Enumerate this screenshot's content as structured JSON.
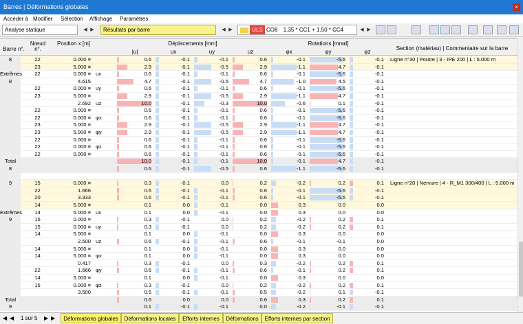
{
  "window": {
    "title": "Barres | Déformations globales",
    "close": "×"
  },
  "menu": [
    "Accéder à",
    "Modifier",
    "Sélection",
    "Affichage",
    "Paramètres"
  ],
  "toolbar": {
    "analysis": "Analyse statique",
    "results": "Résultats par barre",
    "uls": "ULS",
    "co": "CO8",
    "combo": "1.35 * CC1 + 1.50 * CC4"
  },
  "headers": {
    "bar": "Barre n°.",
    "node": "Nœud n°.",
    "pos": "Position x [m]",
    "disp_group": "Déplacements [mm]",
    "rot_group": "Rotations [mrad]",
    "u": "|u|",
    "ux": "ux",
    "uy": "uy",
    "uz": "uz",
    "px": "φx",
    "py": "φy",
    "pz": "φz",
    "section": "Section (matériau) | Commentaire sur la barre"
  },
  "rows": [
    {
      "bar": "8",
      "node": "22",
      "pos": "0.000 ≡",
      "lab": "",
      "v": [
        "0.6",
        "-0.1",
        "-0.1",
        "0.6",
        "-0.1",
        "-5.6",
        "-0.1"
      ],
      "com": "Ligne n°30 | Poutre | 3 - IPE 200 | L : 5.000 m",
      "cls": "yellowrow"
    },
    {
      "bar": "",
      "node": "23",
      "pos": "5.000 ≡",
      "lab": "",
      "v": [
        "2.9",
        "-0.1",
        "-0.5",
        "2.9",
        "-1.1",
        "4.7",
        "-0.1"
      ],
      "com": "",
      "cls": "yellowrow"
    },
    {
      "bar": "Extrêmes",
      "node": "22",
      "pos": "0.000 ≡",
      "lab": "ux",
      "v": [
        "0.6",
        "-0.1",
        "-0.1",
        "0.6",
        "-0.1",
        "-5.6",
        "-0.1"
      ],
      "com": "",
      "cls": ""
    },
    {
      "bar": "8",
      "node": "",
      "pos": "4.615",
      "lab": "",
      "v": [
        "4.7",
        "-0.1",
        "-0.5",
        "4.7",
        "-1.0",
        "4.5",
        "-0.1"
      ],
      "com": "",
      "cls": ""
    },
    {
      "bar": "",
      "node": "22",
      "pos": "0.000 ≡",
      "lab": "uy",
      "v": [
        "0.6",
        "-0.1",
        "-0.1",
        "0.6",
        "-0.1",
        "-5.6",
        "-0.1"
      ],
      "com": "",
      "cls": ""
    },
    {
      "bar": "",
      "node": "23",
      "pos": "5.000 ≡",
      "lab": "",
      "v": [
        "2.9",
        "-0.1",
        "-0.5",
        "2.9",
        "-1.1",
        "4.7",
        "-0.1"
      ],
      "com": "",
      "cls": ""
    },
    {
      "bar": "",
      "node": "",
      "pos": "2.692",
      "lab": "uz",
      "v": [
        "10.0",
        "-0.1",
        "-0.3",
        "10.0",
        "-0.6",
        "0.1",
        "-0.1"
      ],
      "com": "",
      "cls": ""
    },
    {
      "bar": "",
      "node": "22",
      "pos": "0.000 ≡",
      "lab": "",
      "v": [
        "0.6",
        "-0.1",
        "-0.1",
        "0.6",
        "-0.1",
        "-5.6",
        "-0.1"
      ],
      "com": "",
      "cls": ""
    },
    {
      "bar": "",
      "node": "22",
      "pos": "0.000 ≡",
      "lab": "φx",
      "v": [
        "0.6",
        "-0.1",
        "-0.1",
        "0.6",
        "-0.1",
        "-5.6",
        "-0.1"
      ],
      "com": "",
      "cls": ""
    },
    {
      "bar": "",
      "node": "23",
      "pos": "5.000 ≡",
      "lab": "",
      "v": [
        "2.9",
        "-0.1",
        "-0.5",
        "2.9",
        "-1.1",
        "4.7",
        "-0.1"
      ],
      "com": "",
      "cls": ""
    },
    {
      "bar": "",
      "node": "23",
      "pos": "5.000 ≡",
      "lab": "φy",
      "v": [
        "2.9",
        "-0.1",
        "-0.5",
        "2.9",
        "-1.1",
        "4.7",
        "-0.1"
      ],
      "com": "",
      "cls": ""
    },
    {
      "bar": "",
      "node": "22",
      "pos": "0.000 ≡",
      "lab": "",
      "v": [
        "0.6",
        "-0.1",
        "-0.1",
        "0.6",
        "-0.1",
        "-5.6",
        "-0.1"
      ],
      "com": "",
      "cls": ""
    },
    {
      "bar": "",
      "node": "22",
      "pos": "0.000 ≡",
      "lab": "φz",
      "v": [
        "0.6",
        "-0.1",
        "-0.1",
        "0.6",
        "-0.1",
        "-5.6",
        "-0.1"
      ],
      "com": "",
      "cls": ""
    },
    {
      "bar": "",
      "node": "22",
      "pos": "0.000 ≡",
      "lab": "",
      "v": [
        "0.6",
        "-0.1",
        "-0.1",
        "0.6",
        "-0.1",
        "-5.6",
        "-0.1"
      ],
      "com": "",
      "cls": ""
    },
    {
      "bar": "Total",
      "node": "",
      "pos": "",
      "lab": "",
      "v": [
        "10.0",
        "-0.1",
        "-0.1",
        "10.0",
        "-0.1",
        "4.7",
        "-0.1"
      ],
      "com": "",
      "cls": "grayrow"
    },
    {
      "bar": "8",
      "node": "",
      "pos": "",
      "lab": "",
      "v": [
        "0.6",
        "-0.1",
        "-0.5",
        "0.6",
        "-1.1",
        "-5.6",
        "-0.1"
      ],
      "com": "",
      "cls": "grayrow"
    },
    {
      "bar": "",
      "node": "",
      "pos": "",
      "lab": "",
      "v": [
        "",
        "",
        "",
        "",
        "",
        "",
        ""
      ],
      "com": "",
      "cls": ""
    },
    {
      "bar": "9",
      "node": "15",
      "pos": "0.000 ≡",
      "lab": "",
      "v": [
        "0.3",
        "-0.1",
        "0.0",
        "0.2",
        "-0.2",
        "0.2",
        "0.1"
      ],
      "com": "Ligne n°20 | Nervure | 4 - R_M1 300/400 | L : 5.000 m",
      "cls": "yellowrow"
    },
    {
      "bar": "",
      "node": "22",
      "pos": "1.666",
      "lab": "",
      "v": [
        "0.6",
        "-0.1",
        "-0.1",
        "0.6",
        "-0.1",
        "-5.6",
        "-0.1"
      ],
      "com": "",
      "cls": "yellowrow"
    },
    {
      "bar": "",
      "node": "20",
      "pos": "3.333",
      "lab": "",
      "v": [
        "0.6",
        "-0.1",
        "-0.1",
        "0.6",
        "-0.1",
        "-5.6",
        "-0.1"
      ],
      "com": "",
      "cls": "yellowrow"
    },
    {
      "bar": "",
      "node": "14",
      "pos": "5.000 ≡",
      "lab": "",
      "v": [
        "0.1",
        "0.0",
        "-0.1",
        "0.0",
        "0.3",
        "0.0",
        "0.0"
      ],
      "com": "",
      "cls": "yellowrow"
    },
    {
      "bar": "Extrêmes",
      "node": "14",
      "pos": "5.000 ≡",
      "lab": "ux",
      "v": [
        "0.1",
        "0.0",
        "-0.1",
        "0.0",
        "0.3",
        "0.0",
        "0.0"
      ],
      "com": "",
      "cls": ""
    },
    {
      "bar": "9",
      "node": "15",
      "pos": "0.000 ≡",
      "lab": "",
      "v": [
        "0.3",
        "-0.1",
        "0.0",
        "0.2",
        "-0.2",
        "0.2",
        "0.1"
      ],
      "com": "",
      "cls": ""
    },
    {
      "bar": "",
      "node": "15",
      "pos": "0.000 ≡",
      "lab": "uy",
      "v": [
        "0.3",
        "-0.1",
        "0.0",
        "0.2",
        "-0.2",
        "0.2",
        "0.1"
      ],
      "com": "",
      "cls": ""
    },
    {
      "bar": "",
      "node": "14",
      "pos": "5.000 ≡",
      "lab": "",
      "v": [
        "0.1",
        "0.0",
        "-0.1",
        "0.0",
        "0.3",
        "0.0",
        "0.0"
      ],
      "com": "",
      "cls": ""
    },
    {
      "bar": "",
      "node": "",
      "pos": "2.500",
      "lab": "uz",
      "v": [
        "0.6",
        "-0.1",
        "-0.1",
        "0.6",
        "-0.1",
        "-0.1",
        "0.0"
      ],
      "com": "",
      "cls": ""
    },
    {
      "bar": "",
      "node": "14",
      "pos": "5.000 ≡",
      "lab": "",
      "v": [
        "0.1",
        "0.0",
        "-0.1",
        "0.0",
        "0.3",
        "0.0",
        "0.0"
      ],
      "com": "",
      "cls": ""
    },
    {
      "bar": "",
      "node": "14",
      "pos": "5.000 ≡",
      "lab": "φx",
      "v": [
        "0.1",
        "0.0",
        "-0.1",
        "0.0",
        "0.3",
        "0.0",
        "0.0"
      ],
      "com": "",
      "cls": ""
    },
    {
      "bar": "",
      "node": "",
      "pos": "0.417",
      "lab": "",
      "v": [
        "0.3",
        "-0.1",
        "0.0",
        "0.3",
        "-0.2",
        "0.2",
        "0.1"
      ],
      "com": "",
      "cls": ""
    },
    {
      "bar": "",
      "node": "22",
      "pos": "1.666",
      "lab": "φy",
      "v": [
        "0.6",
        "-0.1",
        "-0.1",
        "0.6",
        "-0.1",
        "0.2",
        "0.1"
      ],
      "com": "",
      "cls": ""
    },
    {
      "bar": "",
      "node": "14",
      "pos": "5.000 ≡",
      "lab": "",
      "v": [
        "0.1",
        "0.0",
        "-0.1",
        "0.0",
        "0.3",
        "0.0",
        "0.0"
      ],
      "com": "",
      "cls": ""
    },
    {
      "bar": "",
      "node": "15",
      "pos": "0.000 ≡",
      "lab": "φz",
      "v": [
        "0.3",
        "-0.1",
        "0.0",
        "0.2",
        "-0.2",
        "0.2",
        "0.1"
      ],
      "com": "",
      "cls": ""
    },
    {
      "bar": "",
      "node": "",
      "pos": "3.500",
      "lab": "",
      "v": [
        "0.5",
        "-0.1",
        "-0.1",
        "0.5",
        "-0.2",
        "0.1",
        "-0.1"
      ],
      "com": "",
      "cls": ""
    },
    {
      "bar": "Total",
      "node": "",
      "pos": "",
      "lab": "",
      "v": [
        "0.6",
        "0.0",
        "0.0",
        "0.6",
        "0.3",
        "0.2",
        "0.1"
      ],
      "com": "",
      "cls": "grayrow"
    },
    {
      "bar": "9",
      "node": "",
      "pos": "",
      "lab": "",
      "v": [
        "0.1",
        "-0.1",
        "-0.1",
        "0.0",
        "-0.2",
        "-0.1",
        "-0.1"
      ],
      "com": "",
      "cls": "grayrow"
    }
  ],
  "pager": {
    "label": "1 sur 5"
  },
  "tabs": [
    "Déformations globales",
    "Déformations locales",
    "Efforts internes",
    "Déformations",
    "Efforts internes par section"
  ]
}
